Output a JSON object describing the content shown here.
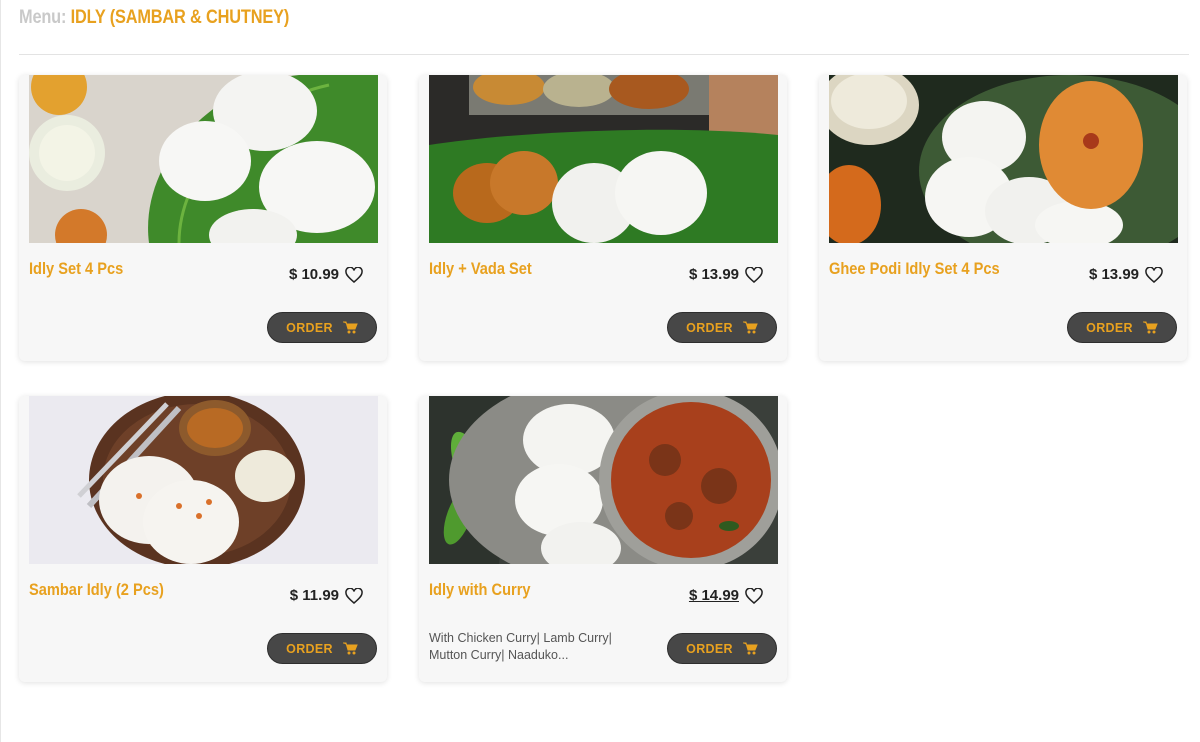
{
  "header": {
    "prefix": "Menu:",
    "category": "IDLY (SAMBAR & CHUTNEY)"
  },
  "order_label": "ORDER",
  "items": [
    {
      "name": "Idly Set 4 Pcs",
      "price": "$ 10.99",
      "description": ""
    },
    {
      "name": "Idly + Vada Set",
      "price": "$ 13.99",
      "description": ""
    },
    {
      "name": "Ghee Podi Idly Set 4 Pcs",
      "price": "$ 13.99",
      "description": ""
    },
    {
      "name": "Sambar Idly (2 Pcs)",
      "price": "$ 11.99",
      "description": ""
    },
    {
      "name": "Idly with Curry",
      "price": "$ 14.99",
      "description": "With Chicken Curry| Lamb Curry| Mutton Curry| Naaduko..."
    }
  ],
  "icons": {
    "favorite": "heart-outline-icon",
    "order": "cart-icon"
  },
  "colors": {
    "accent": "#e8a11f",
    "button": "#474747",
    "card": "#f7f7f7"
  }
}
